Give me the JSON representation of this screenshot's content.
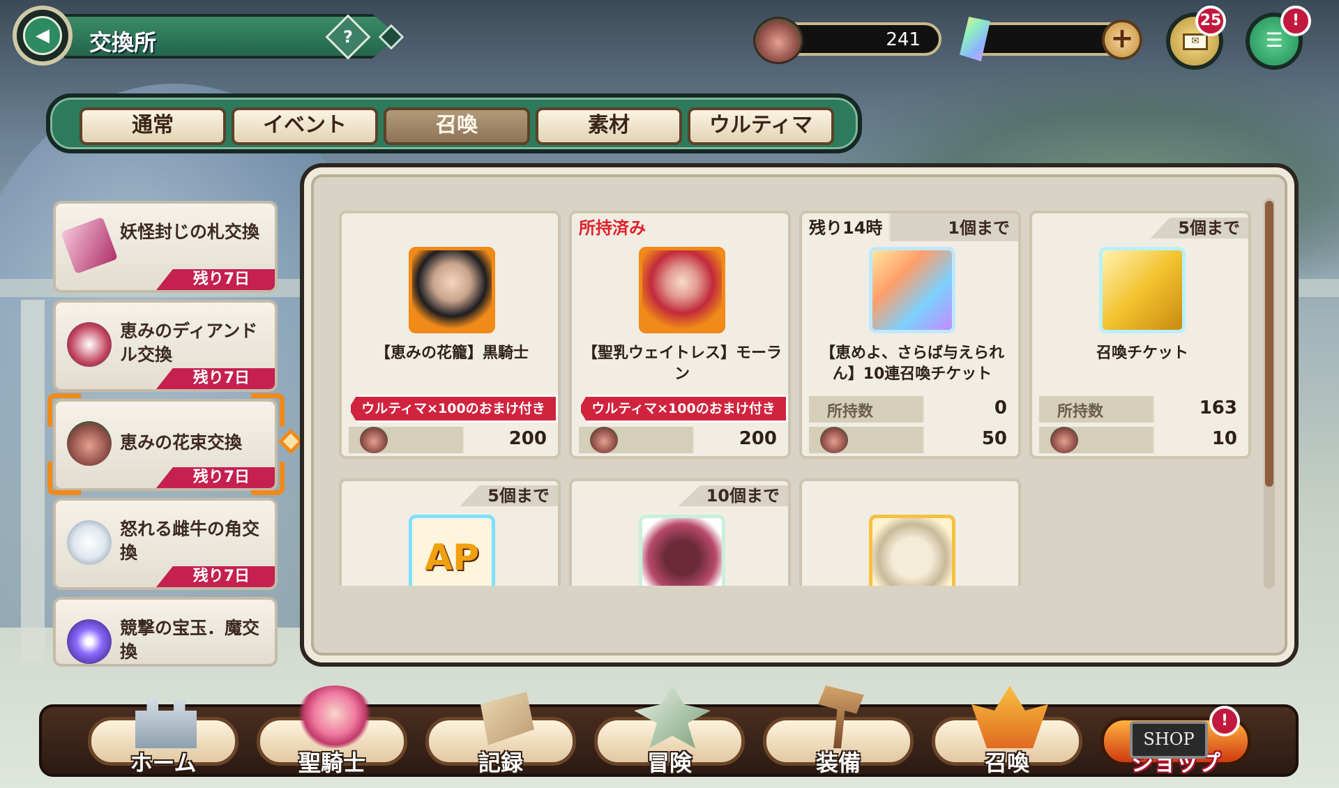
{
  "header": {
    "title": "交換所",
    "help_label": "?"
  },
  "currency": {
    "flower_count": "241"
  },
  "mail": {
    "badge": "25"
  },
  "menu": {
    "badge": "!"
  },
  "tabs": [
    {
      "label": "通常",
      "active": false
    },
    {
      "label": "イベント",
      "active": false
    },
    {
      "label": "召喚",
      "active": true
    },
    {
      "label": "素材",
      "active": false
    },
    {
      "label": "ウルティマ",
      "active": false
    }
  ],
  "sidebar": {
    "items": [
      {
        "label": "妖怪封じの札交換",
        "remaining": "残り7日",
        "icon": "talisman-icon"
      },
      {
        "label": "恵みのディアンドル交換",
        "remaining": "残り7日",
        "icon": "dirndl-icon"
      },
      {
        "label": "恵みの花束交換",
        "remaining": "残り7日",
        "icon": "bouquet-icon",
        "selected": true
      },
      {
        "label": "怒れる雌牛の角交換",
        "remaining": "残り7日",
        "icon": "horn-icon"
      },
      {
        "label": "競撃の宝玉．魔交換",
        "remaining": "",
        "icon": "orb-icon"
      }
    ]
  },
  "cards": [
    {
      "top_left": "",
      "limit": "",
      "name": "【恵みの花籠】黒騎士",
      "ribbon": "ウルティマ×100のおまけ付き",
      "owned_label": "",
      "owned": "",
      "cost": "200"
    },
    {
      "top_left": "所持済み",
      "limit": "",
      "name": "【聖乳ウェイトレス】モーラン",
      "ribbon": "ウルティマ×100のおまけ付き",
      "owned_label": "",
      "owned": "",
      "cost": "200"
    },
    {
      "top_left": "残り14時",
      "limit": "1個まで",
      "name": "【恵めよ、さらば与えられん】10連召喚チケット",
      "ribbon": "",
      "owned_label": "所持数",
      "owned": "0",
      "cost": "50"
    },
    {
      "top_left": "",
      "limit": "5個まで",
      "name": "召喚チケット",
      "ribbon": "",
      "owned_label": "所持数",
      "owned": "163",
      "cost": "10"
    },
    {
      "top_left": "",
      "limit": "5個まで",
      "name": "",
      "ribbon": "",
      "owned_label": "",
      "owned": "",
      "cost": ""
    },
    {
      "top_left": "",
      "limit": "10個まで",
      "name": "",
      "ribbon": "",
      "owned_label": "",
      "owned": "",
      "cost": ""
    },
    {
      "top_left": "",
      "limit": "",
      "name": "",
      "ribbon": "",
      "owned_label": "",
      "owned": "",
      "cost": ""
    }
  ],
  "ap_label": "AP",
  "nav": [
    {
      "label": "ホーム",
      "icon": "castle-icon"
    },
    {
      "label": "聖騎士",
      "icon": "knight-icon"
    },
    {
      "label": "記録",
      "icon": "scroll-quill-icon"
    },
    {
      "label": "冒険",
      "icon": "crossed-swords-icon"
    },
    {
      "label": "装備",
      "icon": "hammer-anvil-icon"
    },
    {
      "label": "召喚",
      "icon": "summon-crystal-icon"
    },
    {
      "label": "ショップ",
      "icon": "shop-sign-icon",
      "badge": "!",
      "sign": "SHOP"
    }
  ],
  "colors": {
    "accent_green": "#2d7a5c",
    "tag_red": "#c42050",
    "ribbon_red": "#d0243e",
    "owned_red": "#e0202a"
  }
}
